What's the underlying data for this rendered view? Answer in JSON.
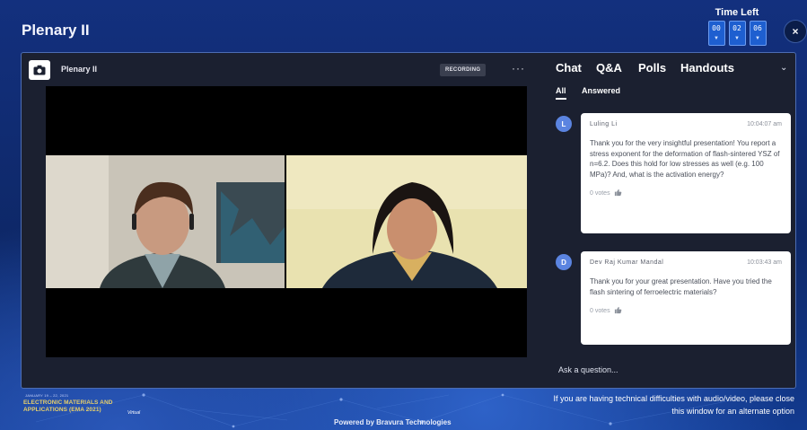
{
  "header": {
    "title": "Plenary II",
    "time_left_label": "Time Left",
    "timer": [
      {
        "value": "00",
        "arrow": "▼"
      },
      {
        "value": "02",
        "arrow": "▼"
      },
      {
        "value": "06",
        "arrow": "▼"
      }
    ],
    "close_label": "×"
  },
  "video": {
    "title": "Plenary II",
    "recording_label": "RECORDING",
    "more_label": "···"
  },
  "side": {
    "tabs": [
      "Chat",
      "Q&A",
      "Polls",
      "Handouts"
    ],
    "active_tab": "Q&A",
    "chevron": "⌄",
    "subtabs": [
      "All",
      "Answered"
    ],
    "questions": [
      {
        "initial": "L",
        "name": "Luling Li",
        "time": "10:04:07 am",
        "text": "Thank you for the very insightful presentation! You report a stress exponent for the deformation of flash-sintered YSZ of n=6.2. Does this hold for low stresses as well (e.g. 100 MPa)? And, what is the activation energy?",
        "votes": "0 votes"
      },
      {
        "initial": "D",
        "name": "Dev Raj Kumar Mandal",
        "time": "10:03:43 am",
        "text": "Thank you for your great presentation. Have you tried the flash sintering of ferroelectric materials?",
        "votes": "0 votes"
      }
    ],
    "ask_placeholder": "Ask a question..."
  },
  "footer": {
    "event_date": "JANUARY 19 – 22, 2021",
    "event_name_line1": "Electronic Materials and",
    "event_name_line2": "Applications (EMA 2021)",
    "event_sub": "Virtual",
    "notice_line1": "If you are having technical difficulties with audio/video, please close",
    "notice_line2": "this window for an alternate option",
    "powered_by": "Powered by Bravura Technologies"
  },
  "colors": {
    "background": "#0f2a73",
    "panel": "#1b2030",
    "accent": "#1e5fd0",
    "avatar": "#5b84e0"
  }
}
